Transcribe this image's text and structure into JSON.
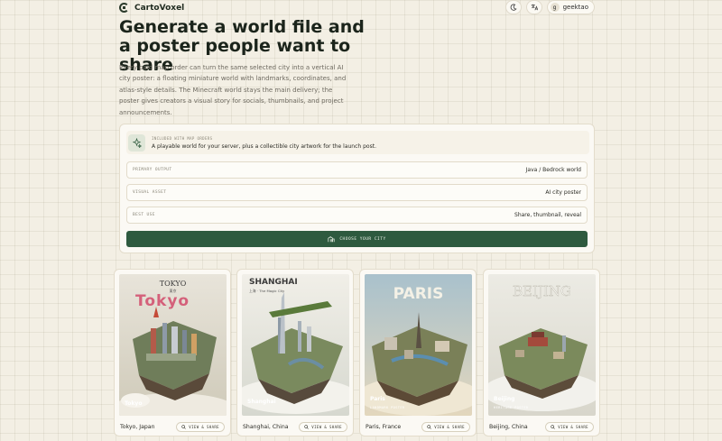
{
  "app": {
    "name": "CartoVoxel"
  },
  "header": {
    "theme_icon": "moon-icon",
    "language_icon": "translate-icon",
    "user_initial": "g",
    "username": "geektao"
  },
  "hero": {
    "title": "Generate a world file and a poster people want to share",
    "description": "Every paid map order can turn the same selected city into a vertical AI city poster: a floating miniature world with landmarks, coordinates, and atlas-style details. The Minecraft world stays the main delivery; the poster gives creators a visual story for socials, thumbnails, and project announcements."
  },
  "included": {
    "label": "INCLUDED WITH MAP ORDERS",
    "description": "A playable world for your server, plus a collectible city artwork for the launch post."
  },
  "details": [
    {
      "label": "PRIMARY OUTPUT",
      "value": "Java / Bedrock world"
    },
    {
      "label": "VISUAL ASSET",
      "value": "AI city poster"
    },
    {
      "label": "BEST USE",
      "value": "Share, thumbnail, reveal"
    }
  ],
  "cta": {
    "label": "CHOOSE YOUR CITY"
  },
  "posters": [
    {
      "city": "Tokyo, Japan",
      "poster_title": "TOKYO",
      "poster_subtitle": "東京",
      "poster_banner": "Tokyo",
      "caption_city": "Tokyo",
      "caption_sub": "",
      "button": "VIEW & SHARE"
    },
    {
      "city": "Shanghai, China",
      "poster_title": "SHANGHAI",
      "poster_subtitle": "上海 · The Magic City",
      "poster_banner": "",
      "caption_city": "Shanghai",
      "caption_sub": "",
      "button": "VIEW & SHARE"
    },
    {
      "city": "Paris, France",
      "poster_title": "PARIS",
      "poster_subtitle": "",
      "poster_banner": "",
      "caption_city": "Paris",
      "caption_sub": "LANDMARK POSTER",
      "button": "VIEW & SHARE"
    },
    {
      "city": "Beijing, China",
      "poster_title": "BEIJING",
      "poster_subtitle": "",
      "poster_banner": "",
      "caption_city": "Beijing",
      "caption_sub": "HERITAGE POSTER",
      "button": "VIEW & SHARE"
    }
  ],
  "colors": {
    "accent": "#2e5a3f",
    "background": "#f3efe4",
    "card": "#fbf9f4"
  }
}
